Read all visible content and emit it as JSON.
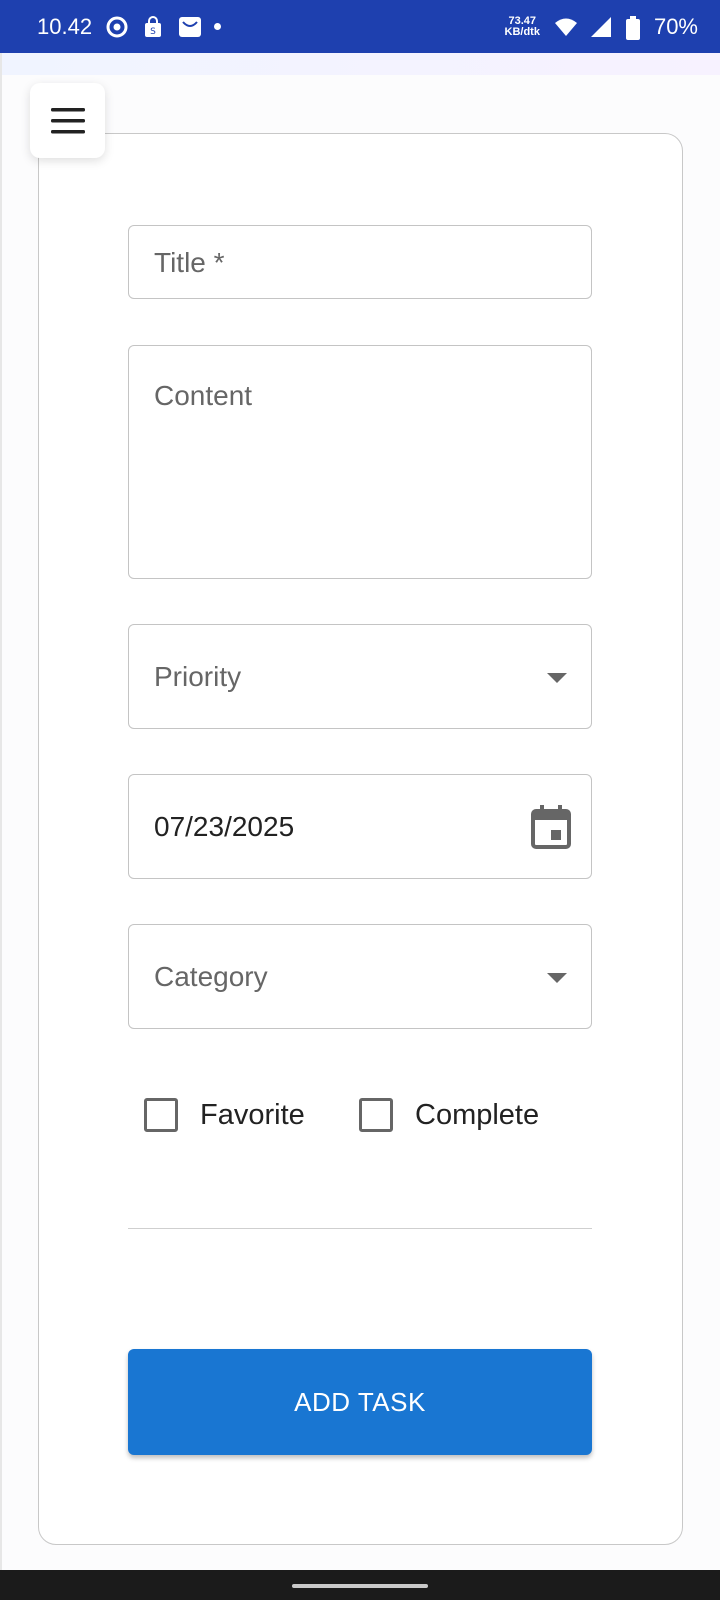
{
  "status_bar": {
    "time": "10.42",
    "net_speed_value": "73.47",
    "net_speed_unit": "KB/dtk",
    "battery_percent": "70%",
    "icons": [
      "chrome-icon",
      "shopping-bag-icon",
      "mail-icon",
      "notification-dot-icon",
      "wifi-icon",
      "signal-icon",
      "battery-icon"
    ]
  },
  "app_bar": {
    "menu_icon": "hamburger-menu-icon"
  },
  "form": {
    "title_placeholder": "Title *",
    "content_placeholder": "Content",
    "priority_placeholder": "Priority",
    "date_value": "07/23/2025",
    "category_placeholder": "Category",
    "favorite_label": "Favorite",
    "complete_label": "Complete",
    "favorite_checked": false,
    "complete_checked": false,
    "submit_label": "ADD TASK"
  },
  "colors": {
    "status_bar": "#1e40af",
    "primary_button": "#1976d2"
  }
}
